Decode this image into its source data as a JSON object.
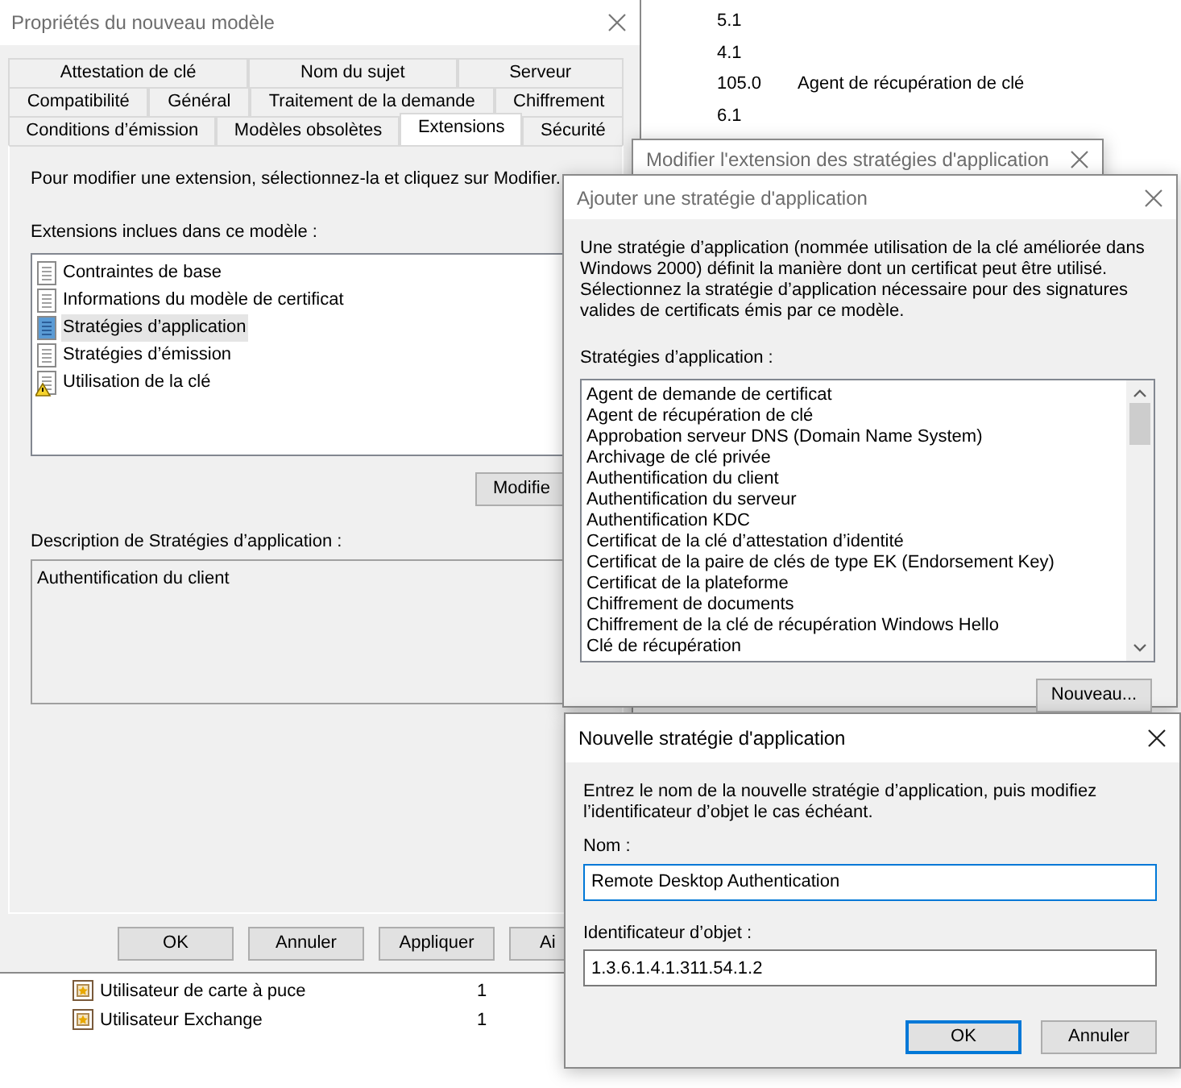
{
  "background_list": {
    "rows_top": [
      {
        "column_1": "5.1"
      },
      {
        "column_1": "4.1"
      },
      {
        "column_1": "105.0",
        "column_2": "Agent de récupération de clé"
      },
      {
        "column_1": "6.1"
      }
    ],
    "rows_bottom": [
      {
        "name": "Utilisateur de carte à puce",
        "column_2": "1"
      },
      {
        "name": "Utilisateur Exchange",
        "column_2": "1"
      }
    ]
  },
  "properties_window": {
    "title": "Propriétés du nouveau modèle",
    "active": false,
    "tab_rows": [
      [
        {
          "label": "Attestation de clé",
          "selected": false
        },
        {
          "label": "Nom du sujet",
          "selected": false
        },
        {
          "label": "Serveur",
          "selected": false
        }
      ],
      [
        {
          "label": "Compatibilité",
          "selected": false
        },
        {
          "label": "Général",
          "selected": false
        },
        {
          "label": "Traitement de la demande",
          "selected": false
        },
        {
          "label": "Chiffrement",
          "selected": false
        }
      ],
      [
        {
          "label": "Conditions d’émission",
          "selected": false
        },
        {
          "label": "Modèles obsolètes",
          "selected": false
        },
        {
          "label": "Extensions",
          "selected": true
        },
        {
          "label": "Sécurité",
          "selected": false
        }
      ]
    ],
    "instruction": "Pour modifier une extension, sélectionnez-la et cliquez sur Modifier.",
    "extensions_label": "Extensions inclues dans ce modèle :",
    "extensions": [
      {
        "label": "Contraintes de base",
        "kind": "plain",
        "selected": false
      },
      {
        "label": "Informations du modèle de certificat",
        "kind": "plain",
        "selected": false
      },
      {
        "label": "Stratégies d’application",
        "kind": "plain",
        "selected": true
      },
      {
        "label": "Stratégies d’émission",
        "kind": "plain",
        "selected": false
      },
      {
        "label": "Utilisation de la clé",
        "kind": "warning",
        "selected": false
      }
    ],
    "modify_button": "Modifie",
    "description_label": "Description de Stratégies d’application :",
    "description": "Authentification du client",
    "buttons": [
      "OK",
      "Annuler",
      "Appliquer",
      "Ai"
    ]
  },
  "modify_window": {
    "title": "Modifier l'extension des stratégies d'application",
    "active": false
  },
  "add_dialog": {
    "title": "Ajouter une stratégie d'application",
    "active": false,
    "text": [
      "Une stratégie d’application (nommée utilisation de la clé améliorée dans",
      "Windows 2000) définit la manière dont un certificat peut être utilisé.",
      "Sélectionnez la stratégie d’application nécessaire pour des signatures",
      "valides de certificats émis par ce modèle."
    ],
    "list_label": "Stratégies d’application :",
    "policies": [
      "Agent de demande de certificat",
      "Agent de récupération de clé",
      "Approbation serveur DNS (Domain Name System)",
      "Archivage de clé privée",
      "Authentification du client",
      "Authentification du serveur",
      "Authentification KDC",
      "Certificat de la clé d’attestation d’identité",
      "Certificat de la paire de clés de type EK (Endorsement Key)",
      "Certificat de la plateforme",
      "Chiffrement de documents",
      "Chiffrement de la clé de récupération Windows Hello",
      "Clé de récupération"
    ],
    "new_button": "Nouveau..."
  },
  "new_policy_dialog": {
    "title": "Nouvelle stratégie d'application",
    "active": true,
    "text": [
      "Entrez le nom de la nouvelle stratégie d’application, puis modifiez",
      "l’identificateur d’objet le cas échéant."
    ],
    "name_field": {
      "label": "Nom :",
      "value": "Remote Desktop Authentication",
      "focused": true
    },
    "oid_field": {
      "label": "Identificateur d’objet :",
      "value": "1.3.6.1.4.1.311.54.1.2",
      "focused": false
    },
    "buttons": [
      {
        "label": "OK",
        "default": true
      },
      {
        "label": "Annuler",
        "default": false
      }
    ]
  }
}
